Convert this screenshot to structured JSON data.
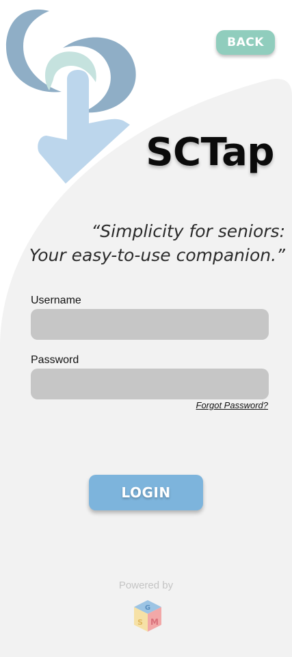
{
  "colors": {
    "panel": "#f2f2f2",
    "back_button": "#90cdbd",
    "login_button": "#7db4dc",
    "input_fill": "#c6c6c6",
    "logo_swirl": "#8faec6",
    "logo_hand": "#bcd6ec",
    "logo_mint": "#c5e2de"
  },
  "header": {
    "back_label": "BACK",
    "app_title": "SCTap",
    "logo_icon": "tap-hand-logo-icon"
  },
  "tagline": {
    "line1": "“Simplicity for seniors:",
    "line2": "Your easy-to-use companion.”"
  },
  "form": {
    "username_label": "Username",
    "username_value": "",
    "password_label": "Password",
    "password_value": "",
    "forgot_label": "Forgot Password?",
    "login_label": "LOGIN"
  },
  "footer": {
    "powered_by": "Powered by",
    "brand_icon": "cube-brand-logo-icon"
  }
}
